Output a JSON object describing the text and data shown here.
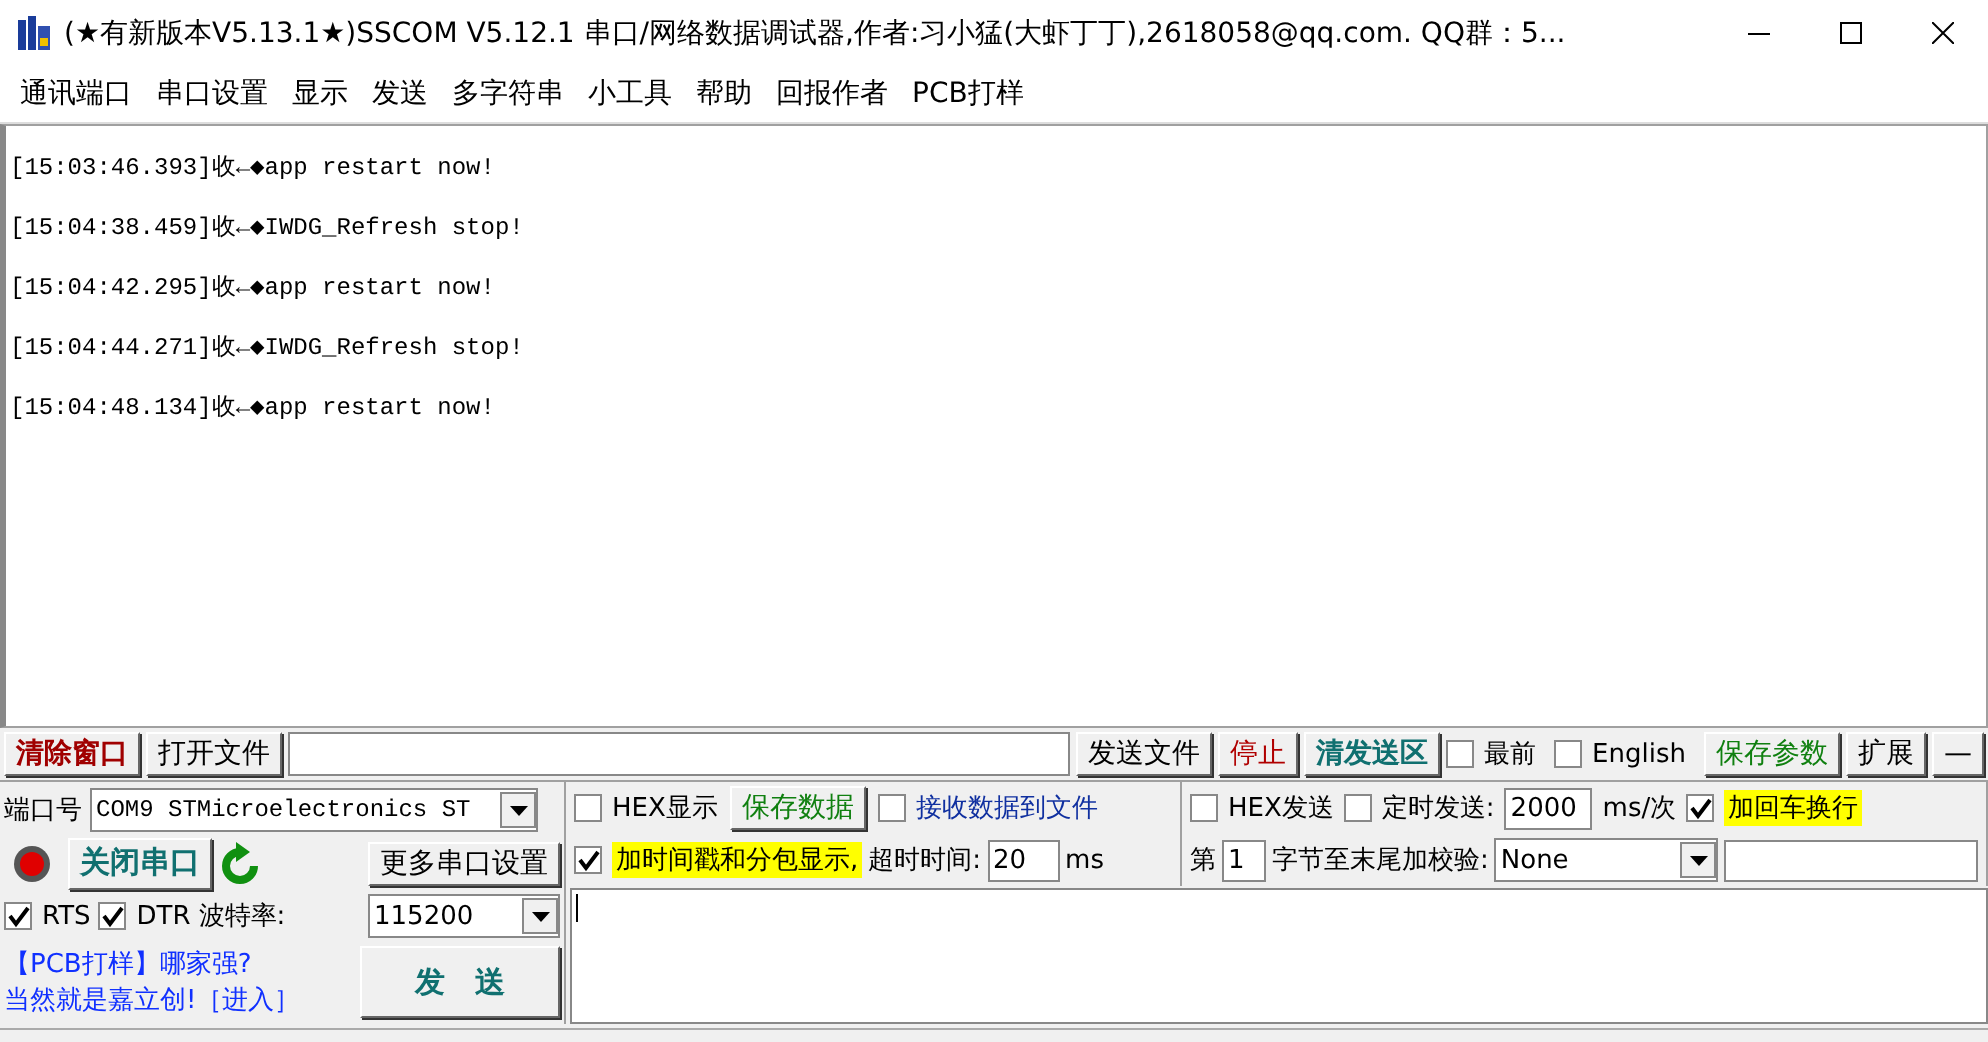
{
  "window": {
    "title": "(★有新版本V5.13.1★)SSCOM V5.12.1 串口/网络数据调试器,作者:习小猛(大虾丁丁),2618058@qq.com. QQ群：5..."
  },
  "menu": [
    "通讯端口",
    "串口设置",
    "显示",
    "发送",
    "多字符串",
    "小工具",
    "帮助",
    "回报作者",
    "PCB打样"
  ],
  "log": {
    "lines": [
      "[15:03:46.393]收←◆app restart now!",
      "[15:04:38.459]收←◆IWDG_Refresh stop!",
      "[15:04:42.295]收←◆app restart now!",
      "[15:04:44.271]收←◆IWDG_Refresh stop!",
      "[15:04:48.134]收←◆app restart now!"
    ]
  },
  "toolbar": {
    "clear_button": "清除窗口",
    "open_file_button": "打开文件",
    "send_file_button": "发送文件",
    "stop_button": "停止",
    "clear_send_button": "清发送区",
    "topmost": {
      "label": "最前",
      "checked": false
    },
    "english": {
      "label": "English",
      "checked": false
    },
    "save_params_button": "保存参数",
    "expand_button": "扩展",
    "collapse_button": "—"
  },
  "port": {
    "label": "端口号",
    "value": "COM9 STMicroelectronics ST",
    "connected": true,
    "toggle_button": "关闭串口",
    "more_settings_button": "更多串口设置",
    "rts": {
      "label": "RTS",
      "checked": true
    },
    "dtr": {
      "label": "DTR",
      "checked": true
    },
    "baud_label": "波特率:",
    "baud_value": "115200",
    "promo_lines": [
      "【PCB打样】哪家强?",
      "当然就是嘉立创!［进入］"
    ],
    "send_button": "发　送"
  },
  "receive": {
    "hex_display": {
      "label": "HEX显示",
      "checked": false,
      "highlighted": false
    },
    "save_data_button": "保存数据",
    "to_file": {
      "label": "接收数据到文件",
      "checked": false,
      "highlighted": false
    },
    "timestamp": {
      "label": "加时间戳和分包显示,",
      "checked": true,
      "highlighted": true
    },
    "timeout_label": "超时时间:",
    "timeout_value": "20",
    "timeout_unit": "ms"
  },
  "send": {
    "hex_send": {
      "label": "HEX发送",
      "checked": false,
      "highlighted": false
    },
    "timed_send": {
      "label": "定时发送:",
      "checked": false,
      "highlighted": false
    },
    "interval_value": "2000",
    "interval_unit": "ms/次",
    "add_crlf": {
      "label": "加回车换行",
      "checked": true,
      "highlighted": true
    },
    "byte_prefix": "第",
    "byte_value": "1",
    "checksum_label": "字节至末尾加校验:",
    "checksum_value": "None"
  }
}
